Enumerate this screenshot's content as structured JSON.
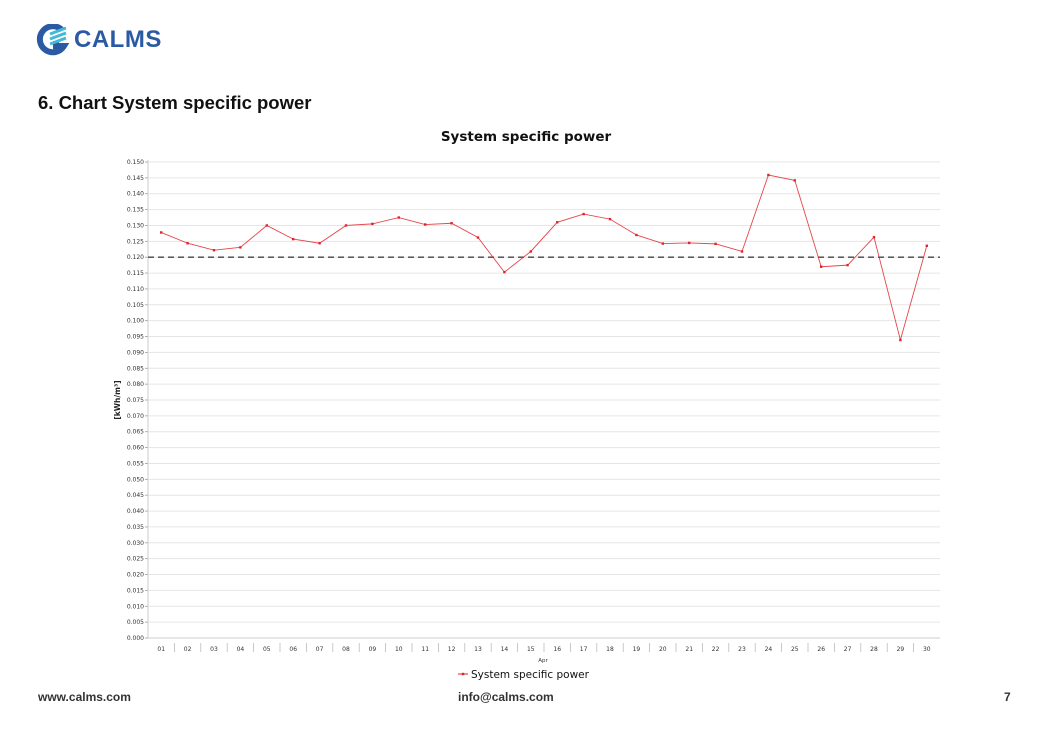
{
  "brand": {
    "name": "CALMS",
    "color": "#2b5aa4",
    "accent": "#45b8d8"
  },
  "section_heading": "6. Chart System specific power",
  "footer": {
    "website": "www.calms.com",
    "email": "info@calms.com",
    "page_number": "7"
  },
  "chart_data": {
    "type": "line",
    "title": "System specific power",
    "xlabel": "Apr",
    "ylabel": "[kWh/m³]",
    "x": [
      "01",
      "02",
      "03",
      "04",
      "05",
      "06",
      "07",
      "08",
      "09",
      "10",
      "11",
      "12",
      "13",
      "14",
      "15",
      "16",
      "17",
      "18",
      "19",
      "20",
      "21",
      "22",
      "23",
      "24",
      "25",
      "26",
      "27",
      "28",
      "29",
      "30"
    ],
    "series": [
      {
        "name": "System specific power",
        "color": "#e0242a",
        "values": [
          0.1278,
          0.1244,
          0.1222,
          0.1231,
          0.13,
          0.1257,
          0.1244,
          0.13,
          0.1305,
          0.1325,
          0.1303,
          0.1307,
          0.1262,
          0.1153,
          0.1218,
          0.131,
          0.1336,
          0.132,
          0.127,
          0.1243,
          0.1245,
          0.1242,
          0.1218,
          0.1459,
          0.1442,
          0.117,
          0.1175,
          0.1263,
          0.0939,
          0.1236
        ]
      }
    ],
    "reference_line": {
      "value": 0.12,
      "style": "dashed",
      "color": "#444444"
    },
    "ylim": [
      0.0,
      0.15
    ],
    "ytick_step": 0.005,
    "grid": true,
    "legend": "bottom-center"
  }
}
